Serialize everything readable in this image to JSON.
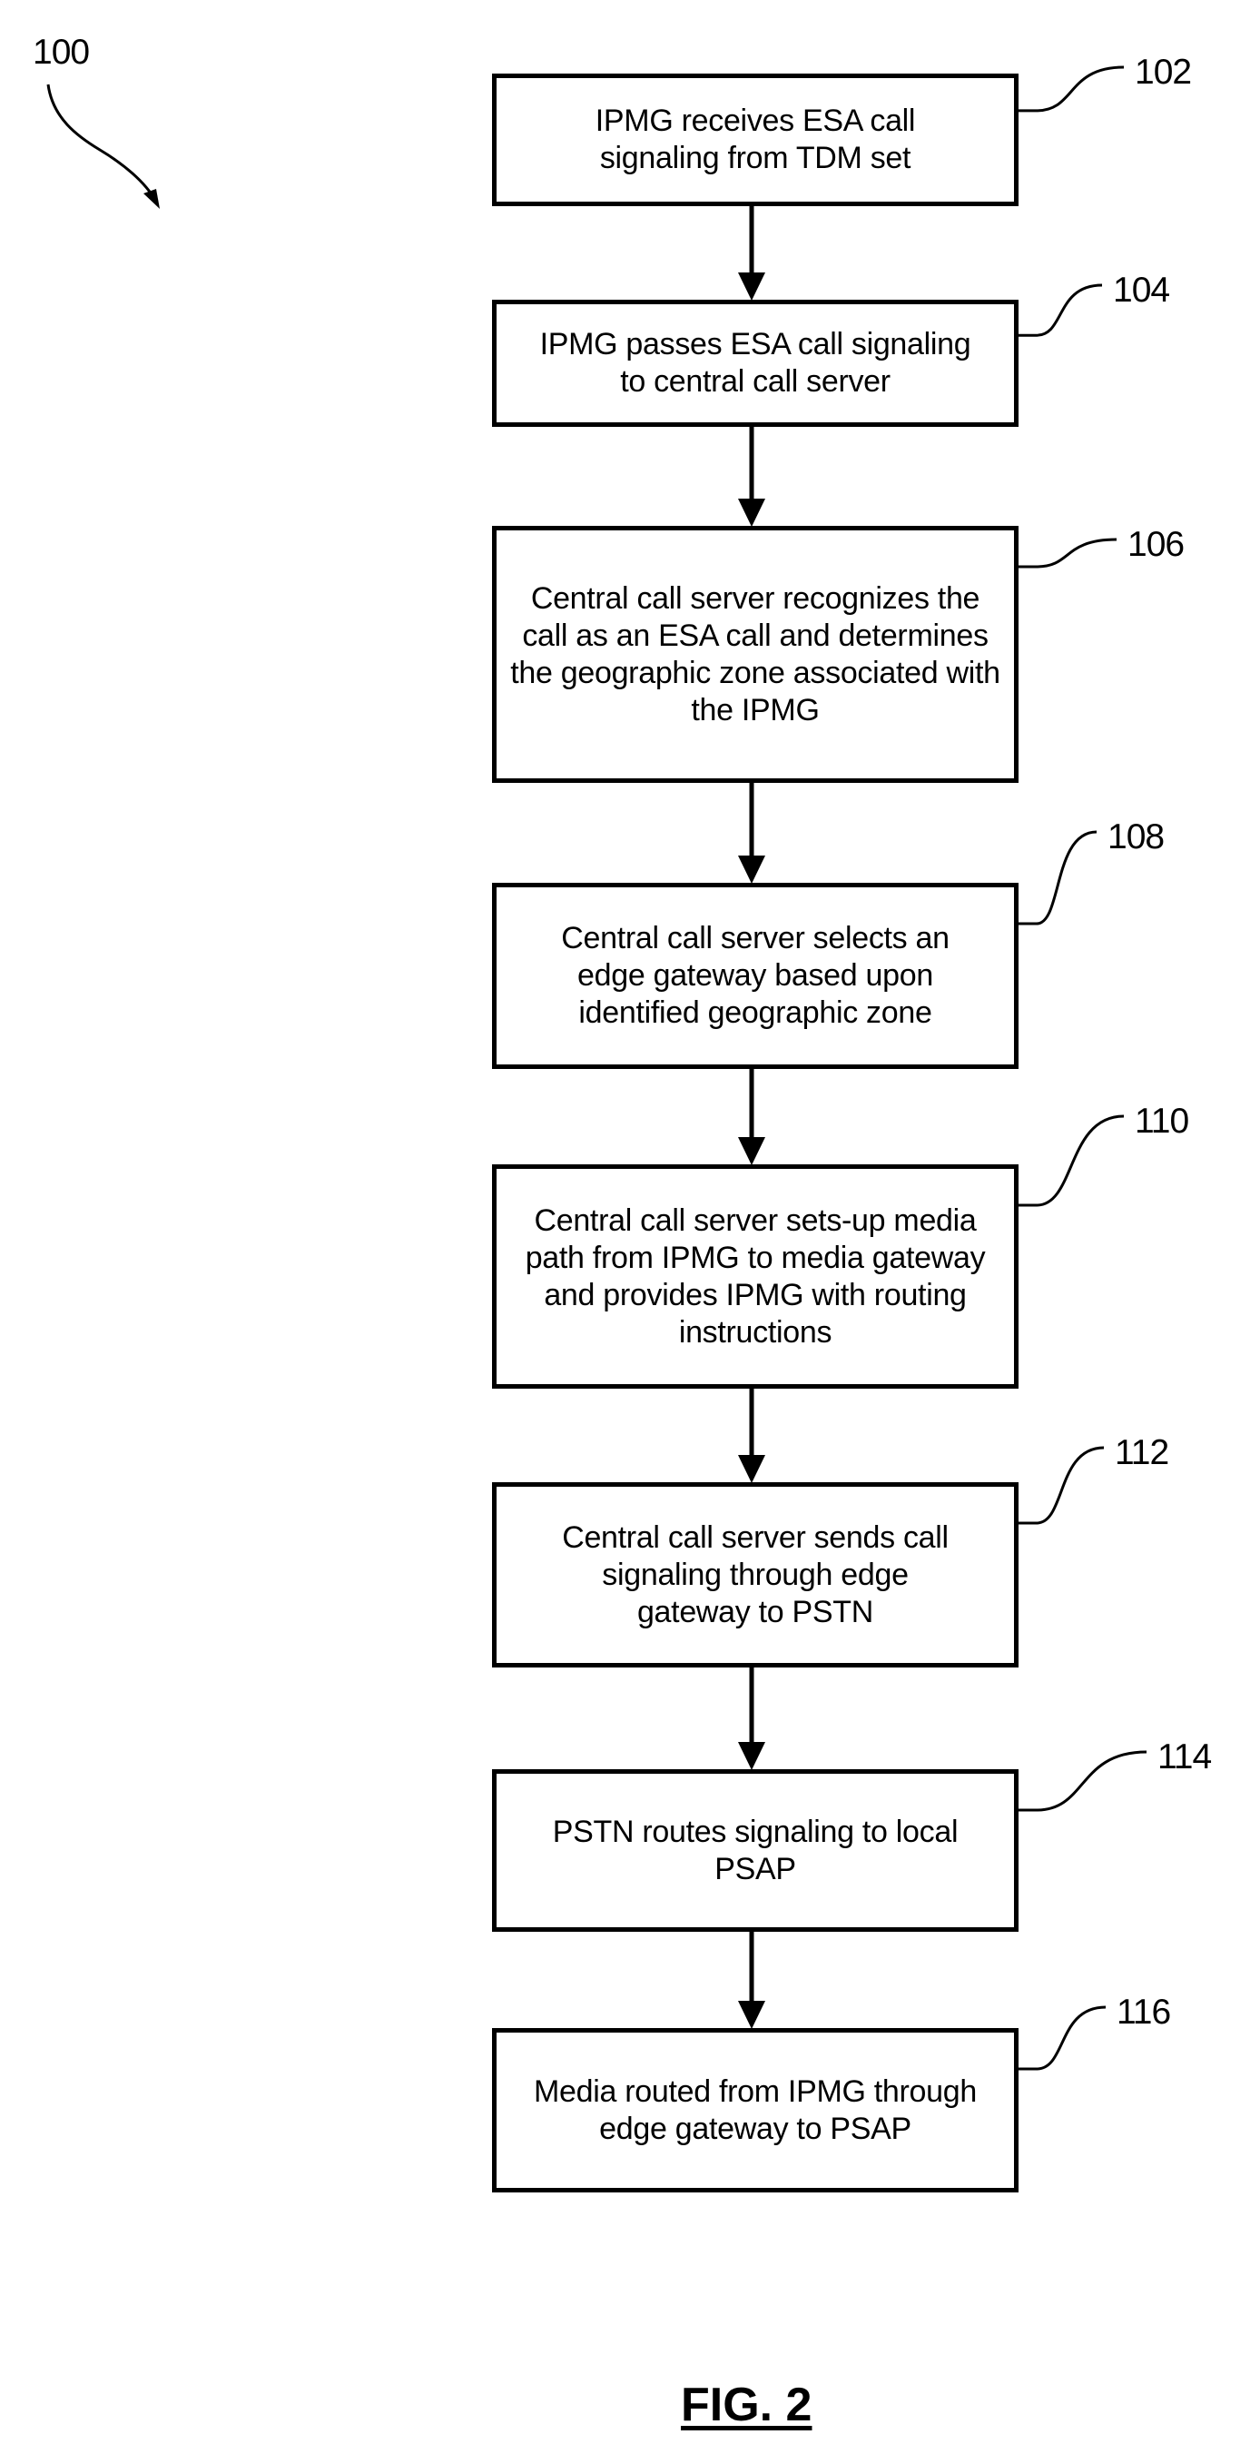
{
  "figure": {
    "label": "FIG. 2",
    "reference": "100"
  },
  "steps": [
    {
      "id": "102",
      "text": "IPMG receives ESA call signaling from TDM set"
    },
    {
      "id": "104",
      "text": "IPMG passes ESA call signaling to central call server"
    },
    {
      "id": "106",
      "text": "Central call server recognizes the call as an ESA call and determines the geographic zone associated with the IPMG"
    },
    {
      "id": "108",
      "text": "Central call server selects an edge gateway based upon identified geographic zone"
    },
    {
      "id": "110",
      "text": "Central call server sets-up media path from IPMG to media gateway and provides IPMG with routing instructions"
    },
    {
      "id": "112",
      "text": "Central call server sends call signaling through edge gateway to PSTN"
    },
    {
      "id": "114",
      "text": "PSTN routes signaling to local PSAP"
    },
    {
      "id": "116",
      "text": "Media routed from IPMG through edge gateway to PSAP"
    }
  ],
  "flow": [
    {
      "from": "102",
      "to": "104"
    },
    {
      "from": "104",
      "to": "106"
    },
    {
      "from": "106",
      "to": "108"
    },
    {
      "from": "108",
      "to": "110"
    },
    {
      "from": "110",
      "to": "112"
    },
    {
      "from": "112",
      "to": "114"
    },
    {
      "from": "114",
      "to": "116"
    }
  ]
}
